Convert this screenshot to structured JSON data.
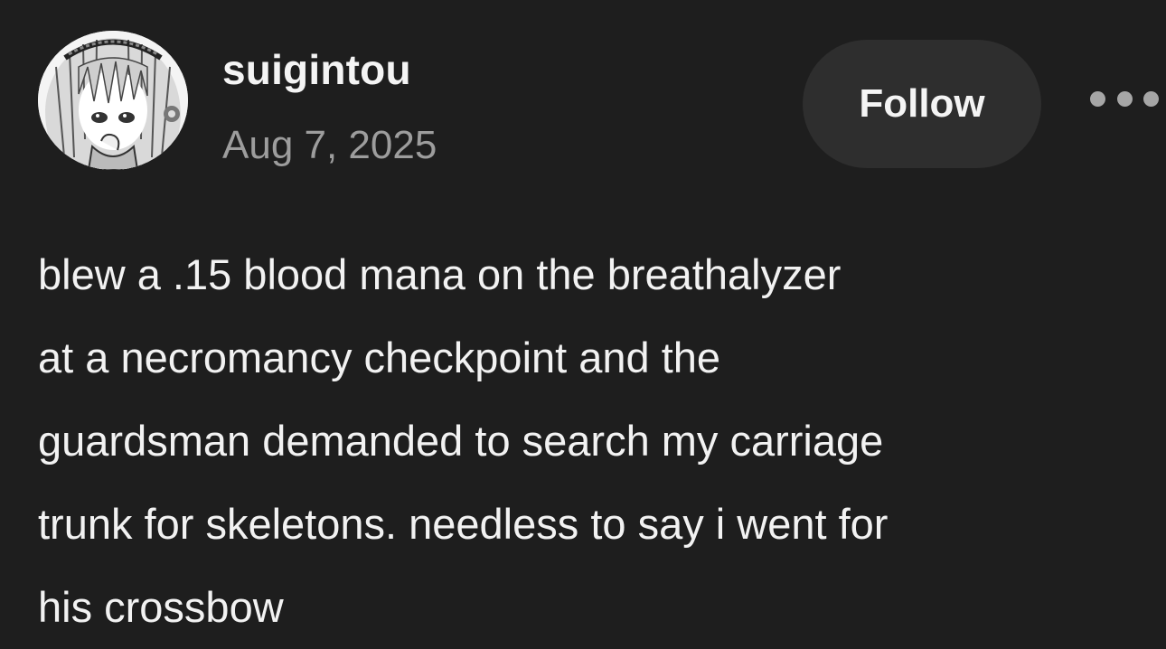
{
  "post": {
    "author": "suigintou",
    "date": "Aug 7, 2025",
    "follow_label": "Follow",
    "more_icon": "more-horizontal-icon",
    "body_lines": [
      "blew a .15 blood mana on the breathalyzer",
      "at a necromancy checkpoint and the",
      "guardsman demanded to search my carriage",
      "trunk for skeletons. needless to say i went for",
      "his crossbow"
    ]
  },
  "colors": {
    "background": "#1e1e1e",
    "text": "#f2f2f2",
    "muted_text": "#9d9d9d",
    "button_bg": "#2e2e2e"
  }
}
